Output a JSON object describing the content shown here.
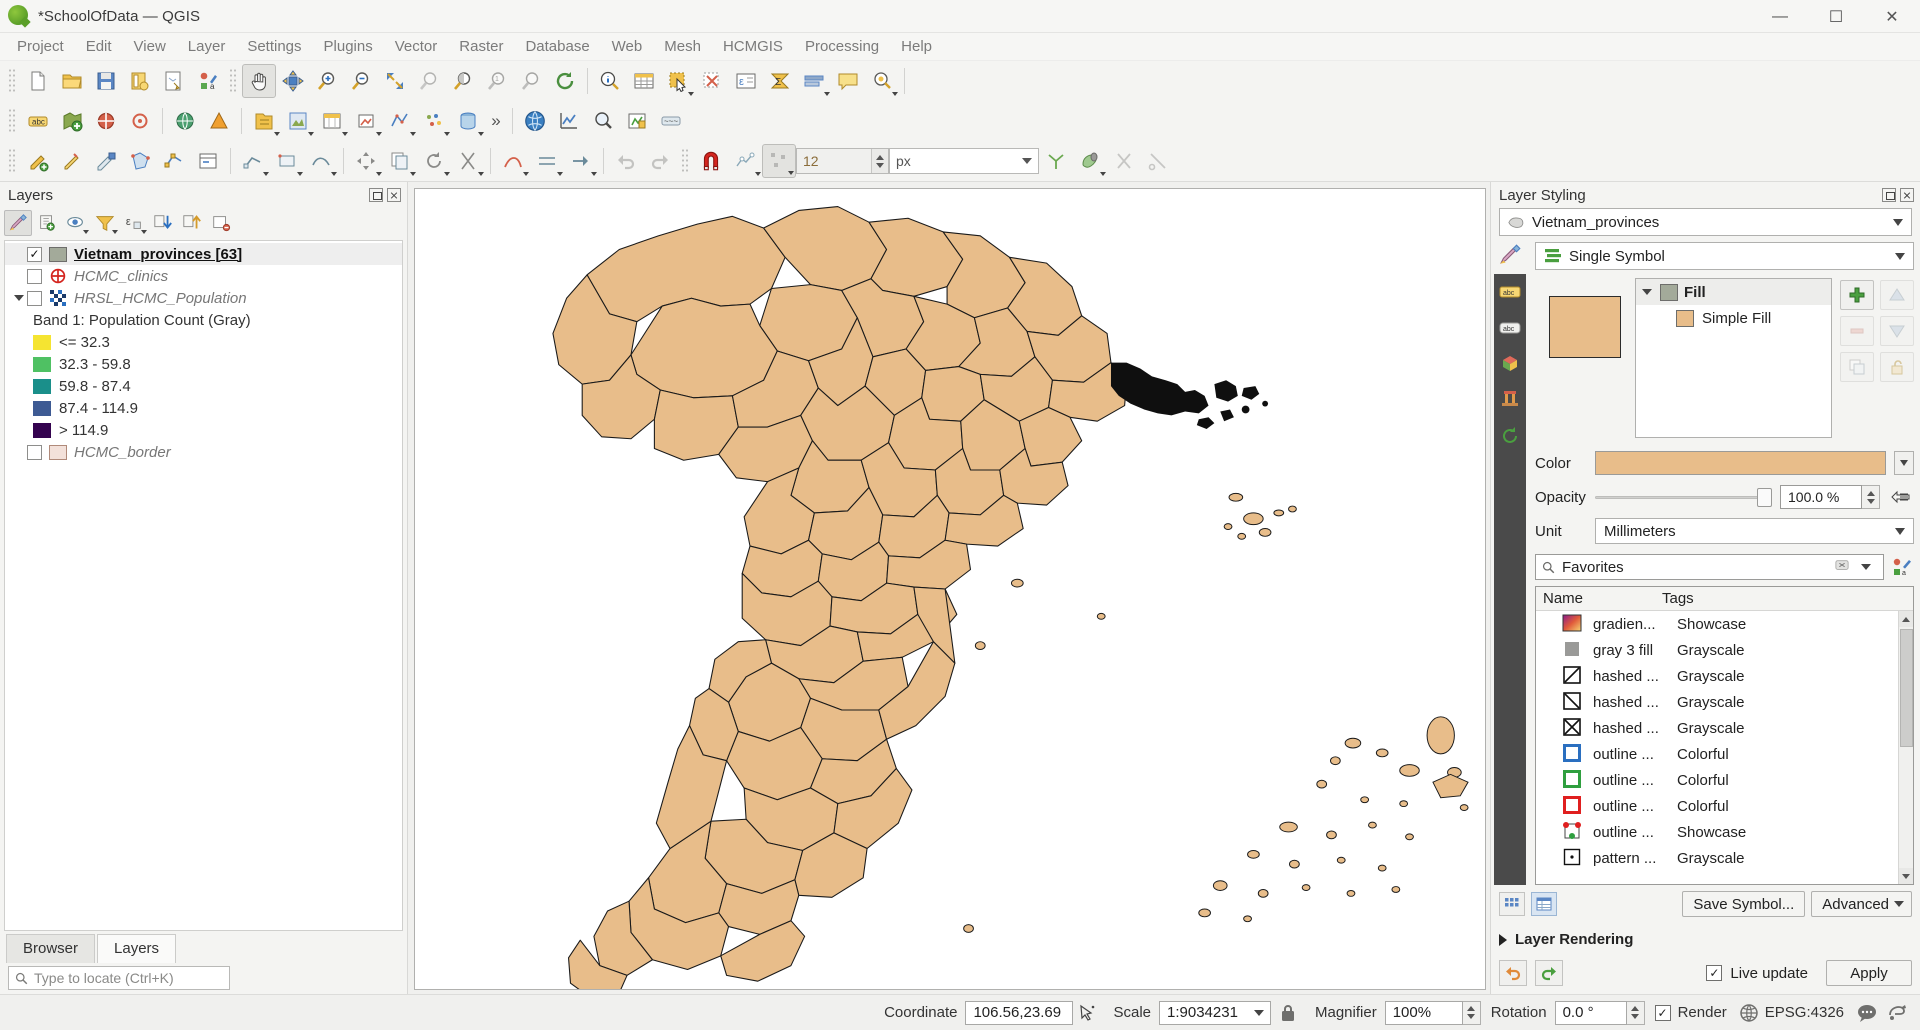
{
  "window": {
    "title": "*SchoolOfData — QGIS",
    "logo_icon": "qgis-logo-icon",
    "minimize_label": "—",
    "maximize_label": "☐",
    "close_label": "✕"
  },
  "menubar": {
    "items": [
      {
        "label": "Project"
      },
      {
        "label": "Edit"
      },
      {
        "label": "View"
      },
      {
        "label": "Layer"
      },
      {
        "label": "Settings"
      },
      {
        "label": "Plugins"
      },
      {
        "label": "Vector"
      },
      {
        "label": "Raster"
      },
      {
        "label": "Database"
      },
      {
        "label": "Web"
      },
      {
        "label": "Mesh"
      },
      {
        "label": "HCMGIS"
      },
      {
        "label": "Processing"
      },
      {
        "label": "Help"
      }
    ]
  },
  "toolbar": {
    "overflow_label": "»",
    "digitizing": {
      "size_value": "12",
      "unit_value": "px"
    }
  },
  "layers_panel": {
    "title": "Layers",
    "tree": [
      {
        "name": "Vietnam_provinces [63]",
        "checked": true,
        "selected": true,
        "swatch": "#a3aa9a",
        "style": "bold"
      },
      {
        "name": "HCMC_clinics",
        "checked": false,
        "icon": "point-marker-icon",
        "style": "italic"
      },
      {
        "name": "HRSL_HCMC_Population",
        "checked": false,
        "icon": "raster-icon",
        "expanded": true,
        "style": "italic"
      }
    ],
    "raster_band_label": "Band 1: Population Count (Gray)",
    "raster_classes": [
      {
        "label": "<= 32.3",
        "color": "#f5e431"
      },
      {
        "label": "32.3 - 59.8",
        "color": "#4fc163"
      },
      {
        "label": "59.8 - 87.4",
        "color": "#1a8f8a"
      },
      {
        "label": "87.4 - 114.9",
        "color": "#3d5a93"
      },
      {
        "label": "> 114.9",
        "color": "#34034f"
      }
    ],
    "border_layer": {
      "name": "HCMC_border",
      "checked": false,
      "swatch": "#f3e1da"
    },
    "tabs": [
      {
        "label": "Browser",
        "active": false
      },
      {
        "label": "Layers",
        "active": true
      }
    ],
    "locator_placeholder": "Type to locate (Ctrl+K)"
  },
  "map": {
    "fill_color": "#e8bd8a",
    "stroke_color": "#1a1a1a",
    "background": "#ffffff"
  },
  "style_panel": {
    "title": "Layer Styling",
    "float_icon": "float-panel-icon",
    "close_icon": "close-icon",
    "layer_select": "Vietnam_provinces",
    "renderer_select": "Single Symbol",
    "symbol_tree": {
      "root_label": "Fill",
      "child_label": "Simple Fill",
      "root_swatch": "#a3aa9a",
      "child_swatch": "#e8bd8a"
    },
    "properties": {
      "color_label": "Color",
      "color_value": "#e8bd8a",
      "opacity_label": "Opacity",
      "opacity_value": "100.0 %",
      "unit_label": "Unit",
      "unit_value": "Millimeters"
    },
    "search_value": "Favorites",
    "symbol_list": {
      "columns": [
        "Name",
        "Tags"
      ],
      "rows": [
        {
          "name": "gradien...",
          "tag": "Showcase",
          "icon": "gradient-swatch-icon"
        },
        {
          "name": "gray 3 fill",
          "tag": "Grayscale",
          "icon": "gray-fill-icon"
        },
        {
          "name": "hashed ...",
          "tag": "Grayscale",
          "icon": "hashed-fill-icon"
        },
        {
          "name": "hashed ...",
          "tag": "Grayscale",
          "icon": "hashed-fill-icon"
        },
        {
          "name": "hashed ...",
          "tag": "Grayscale",
          "icon": "hashed-cross-icon"
        },
        {
          "name": "outline ...",
          "tag": "Colorful",
          "icon": "outline-blue-icon"
        },
        {
          "name": "outline ...",
          "tag": "Colorful",
          "icon": "outline-green-icon"
        },
        {
          "name": "outline ...",
          "tag": "Colorful",
          "icon": "outline-red-icon"
        },
        {
          "name": "outline ...",
          "tag": "Showcase",
          "icon": "outline-marker-icon"
        },
        {
          "name": "pattern ...",
          "tag": "Grayscale",
          "icon": "pattern-dot-icon"
        }
      ]
    },
    "footer": {
      "save_symbol_label": "Save Symbol...",
      "advanced_label": "Advanced",
      "layer_rendering_label": "Layer Rendering",
      "live_update_label": "Live update",
      "live_update_checked": true,
      "apply_label": "Apply"
    }
  },
  "statusbar": {
    "coordinate_label": "Coordinate",
    "coordinate_value": "106.56,23.69",
    "scale_label": "Scale",
    "scale_value": "1:9034231",
    "magnifier_label": "Magnifier",
    "magnifier_value": "100%",
    "rotation_label": "Rotation",
    "rotation_value": "0.0 °",
    "render_label": "Render",
    "render_checked": true,
    "crs_value": "EPSG:4326",
    "messages_icon": "messages-icon",
    "crs_icon": "globe-icon"
  }
}
